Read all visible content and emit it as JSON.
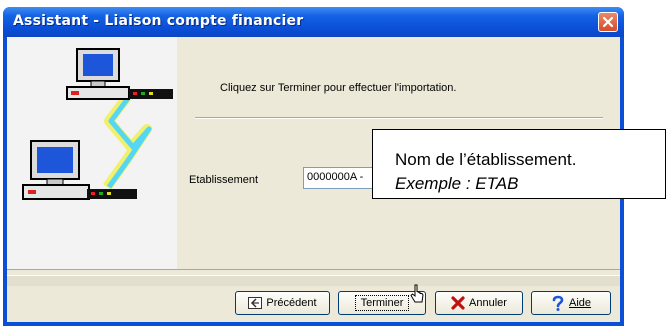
{
  "window": {
    "title": "Assistant - Liaison compte financier"
  },
  "content": {
    "message": "Cliquez sur Terminer pour effectuer l'importation.",
    "etablissement_label": "Etablissement",
    "etablissement_value": "0000000A -"
  },
  "buttons": {
    "previous": "Précédent",
    "finish": "Terminer",
    "cancel": "Annuler",
    "help": "Aide"
  },
  "callout": {
    "line1": "Nom de l’établissement.",
    "line2": "Exemple : ETAB"
  },
  "icons": [
    "close-icon",
    "computer-icon",
    "network-link-icon",
    "previous-icon",
    "cancel-x-icon",
    "help-question-icon",
    "mouse-cursor-icon"
  ]
}
